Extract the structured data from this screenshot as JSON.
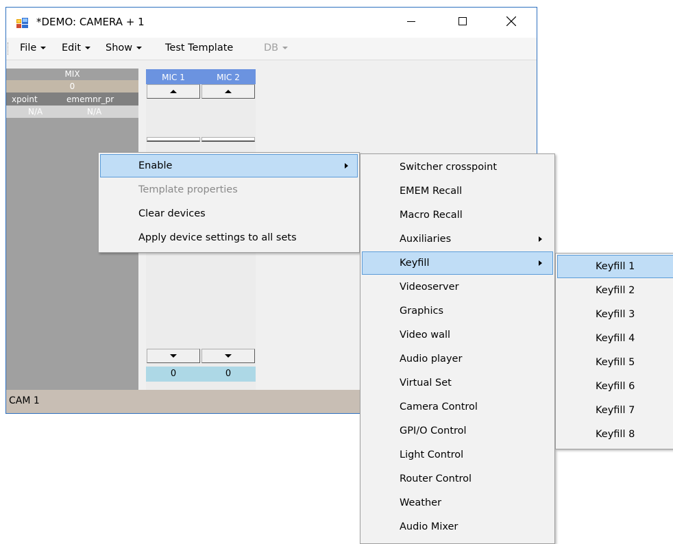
{
  "window": {
    "title": "*DEMO: CAMERA + 1"
  },
  "menubar": {
    "items": [
      {
        "label": "File"
      },
      {
        "label": "Edit"
      },
      {
        "label": "Show"
      },
      {
        "label": "Test Template"
      },
      {
        "label": "DB"
      }
    ]
  },
  "mix": {
    "header": "MIX",
    "value": "0",
    "columns": [
      "xpoint",
      "ememnr_pr"
    ],
    "values": [
      "N/A",
      "N/A"
    ]
  },
  "mics": [
    {
      "label": "MIC 1",
      "level": "0"
    },
    {
      "label": "MIC 2",
      "level": "0"
    }
  ],
  "status": {
    "text": "CAM 1"
  },
  "context_menu": {
    "items": [
      {
        "label": "Enable"
      },
      {
        "label": "Template properties"
      },
      {
        "label": "Clear devices"
      },
      {
        "label": "Apply device settings to all sets"
      }
    ]
  },
  "enable_submenu": {
    "items": [
      {
        "label": "Switcher crosspoint"
      },
      {
        "label": "EMEM Recall"
      },
      {
        "label": "Macro Recall"
      },
      {
        "label": "Auxiliaries"
      },
      {
        "label": "Keyfill"
      },
      {
        "label": "Videoserver"
      },
      {
        "label": "Graphics"
      },
      {
        "label": "Video wall"
      },
      {
        "label": "Audio player"
      },
      {
        "label": "Virtual Set"
      },
      {
        "label": "Camera Control"
      },
      {
        "label": "GPI/O Control"
      },
      {
        "label": "Light Control"
      },
      {
        "label": "Router Control"
      },
      {
        "label": "Weather"
      },
      {
        "label": "Audio Mixer"
      }
    ]
  },
  "keyfill_submenu": {
    "items": [
      {
        "label": "Keyfill 1"
      },
      {
        "label": "Keyfill 2"
      },
      {
        "label": "Keyfill 3"
      },
      {
        "label": "Keyfill 4"
      },
      {
        "label": "Keyfill 5"
      },
      {
        "label": "Keyfill 6"
      },
      {
        "label": "Keyfill 7"
      },
      {
        "label": "Keyfill 8"
      }
    ]
  },
  "colors": {
    "menu_highlight": "#c0ddf6",
    "menu_highlight_border": "#5a9bd8",
    "mic_header": "#6b93e0",
    "level_box": "#add8e6",
    "status_bar": "#c8beb4",
    "window_border": "#2c6fbf"
  }
}
